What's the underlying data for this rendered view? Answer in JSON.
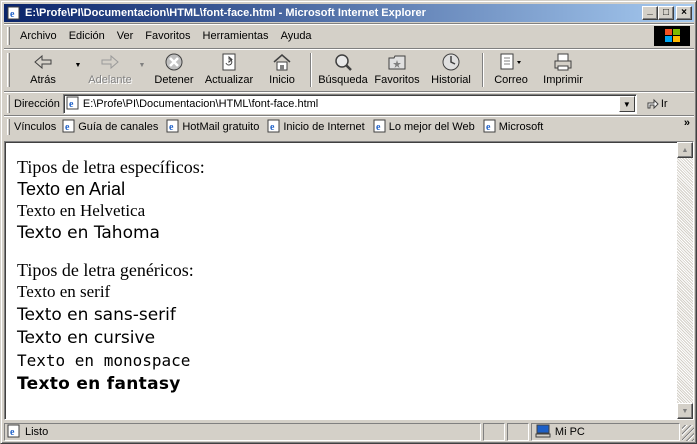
{
  "window": {
    "title": "E:\\Profe\\PI\\Documentacion\\HTML\\font-face.html - Microsoft Internet Explorer",
    "controls": {
      "minimize": "_",
      "maximize": "□",
      "close": "×"
    }
  },
  "menubar": {
    "items": [
      {
        "label": "Archivo",
        "key": "A"
      },
      {
        "label": "Edición",
        "key": "E"
      },
      {
        "label": "Ver",
        "key": "V"
      },
      {
        "label": "Favoritos",
        "key": "F"
      },
      {
        "label": "Herramientas",
        "key": "H"
      },
      {
        "label": "Ayuda",
        "key": "y"
      }
    ]
  },
  "toolbar": {
    "back": "Atrás",
    "forward": "Adelante",
    "stop": "Detener",
    "refresh": "Actualizar",
    "home": "Inicio",
    "search": "Búsqueda",
    "favorites": "Favoritos",
    "history": "Historial",
    "mail": "Correo",
    "print": "Imprimir"
  },
  "address": {
    "label": "Dirección",
    "url": "E:\\Profe\\PI\\Documentacion\\HTML\\font-face.html",
    "go_label": "Ir"
  },
  "links": {
    "label": "Vínculos",
    "items": [
      "Guía de canales",
      "HotMail gratuito",
      "Inicio de Internet",
      "Lo mejor del Web",
      "Microsoft"
    ],
    "more": "»"
  },
  "content": {
    "specific_heading": "Tipos de letra específicos:",
    "specific": [
      "Texto en Arial",
      "Texto en Helvetica",
      "Texto en Tahoma"
    ],
    "generic_heading": "Tipos de letra genéricos:",
    "generic": [
      "Texto en serif",
      "Texto en sans-serif",
      "Texto en cursive",
      "Texto en monospace",
      "Texto en fantasy"
    ]
  },
  "status": {
    "text": "Listo",
    "zone": "Mi PC"
  },
  "colors": {
    "titlebar_start": "#0a246a",
    "titlebar_end": "#a6caf0",
    "chrome": "#d4d0c8"
  },
  "icons": {
    "app": "ie-page-icon",
    "back": "back-arrow-icon",
    "forward": "forward-arrow-icon",
    "stop": "stop-icon",
    "refresh": "refresh-icon",
    "home": "home-icon",
    "search": "search-icon",
    "favorites": "favorites-folder-icon",
    "history": "history-icon",
    "mail": "mail-icon",
    "print": "printer-icon",
    "zone": "computer-icon"
  }
}
